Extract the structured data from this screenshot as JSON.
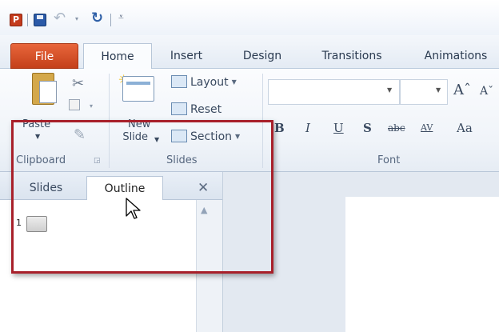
{
  "app": {
    "logo_letter": "P"
  },
  "tabs": [
    {
      "label": "File"
    },
    {
      "label": "Home"
    },
    {
      "label": "Insert"
    },
    {
      "label": "Design"
    },
    {
      "label": "Transitions"
    },
    {
      "label": "Animations"
    }
  ],
  "ribbon": {
    "clipboard": {
      "paste_label": "Paste",
      "group_label": "Clipboard"
    },
    "slides": {
      "new_slide_line1": "New",
      "new_slide_line2": "Slide",
      "layout_label": "Layout",
      "reset_label": "Reset",
      "section_label": "Section",
      "group_label": "Slides"
    },
    "font": {
      "group_label": "Font",
      "bold": "B",
      "italic": "I",
      "underline": "U",
      "shadow": "S",
      "strikethrough": "abc",
      "spacing": "AV",
      "change_case": "Aa"
    }
  },
  "pane": {
    "tab_slides": "Slides",
    "tab_outline": "Outline",
    "slide_number": "1"
  },
  "colors": {
    "file_tab": "#d14a24",
    "highlight_border": "#a8202a"
  }
}
